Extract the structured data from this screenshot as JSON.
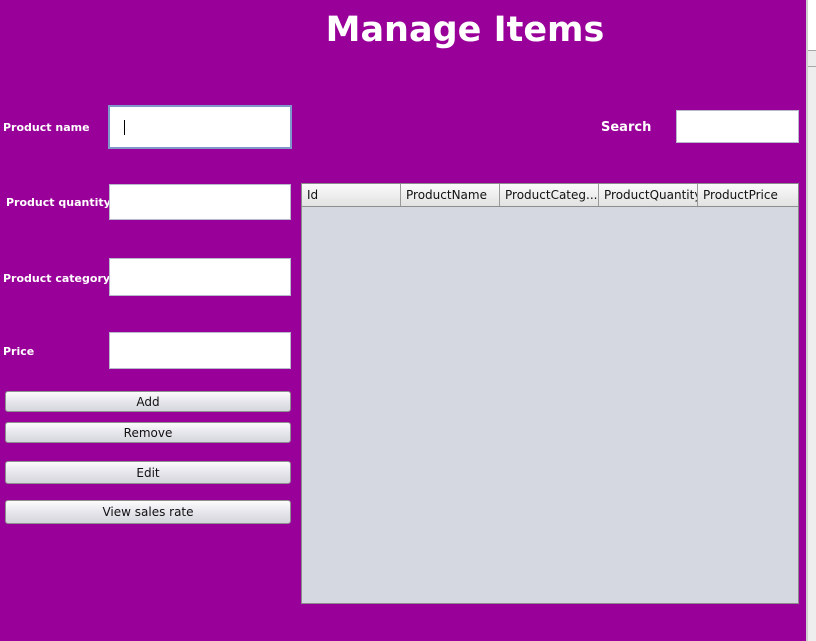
{
  "title": "Manage Items",
  "form": {
    "product_name_label": "Product name",
    "product_name_value": "",
    "product_quantity_label": "Product quantity",
    "product_quantity_value": "",
    "product_category_label": "Product category",
    "product_category_value": "",
    "price_label": "Price",
    "price_value": ""
  },
  "search": {
    "label": "Search",
    "value": ""
  },
  "buttons": {
    "add": "Add",
    "remove": "Remove",
    "edit": "Edit",
    "view_sales_rate": "View sales rate"
  },
  "table": {
    "columns": [
      "Id",
      "ProductName",
      "ProductCateg...",
      "ProductQuantity",
      "ProductPrice"
    ],
    "rows": []
  },
  "colors": {
    "panel_background": "#990099",
    "table_background": "#d5d8e1",
    "text_color": "#ffffff"
  }
}
